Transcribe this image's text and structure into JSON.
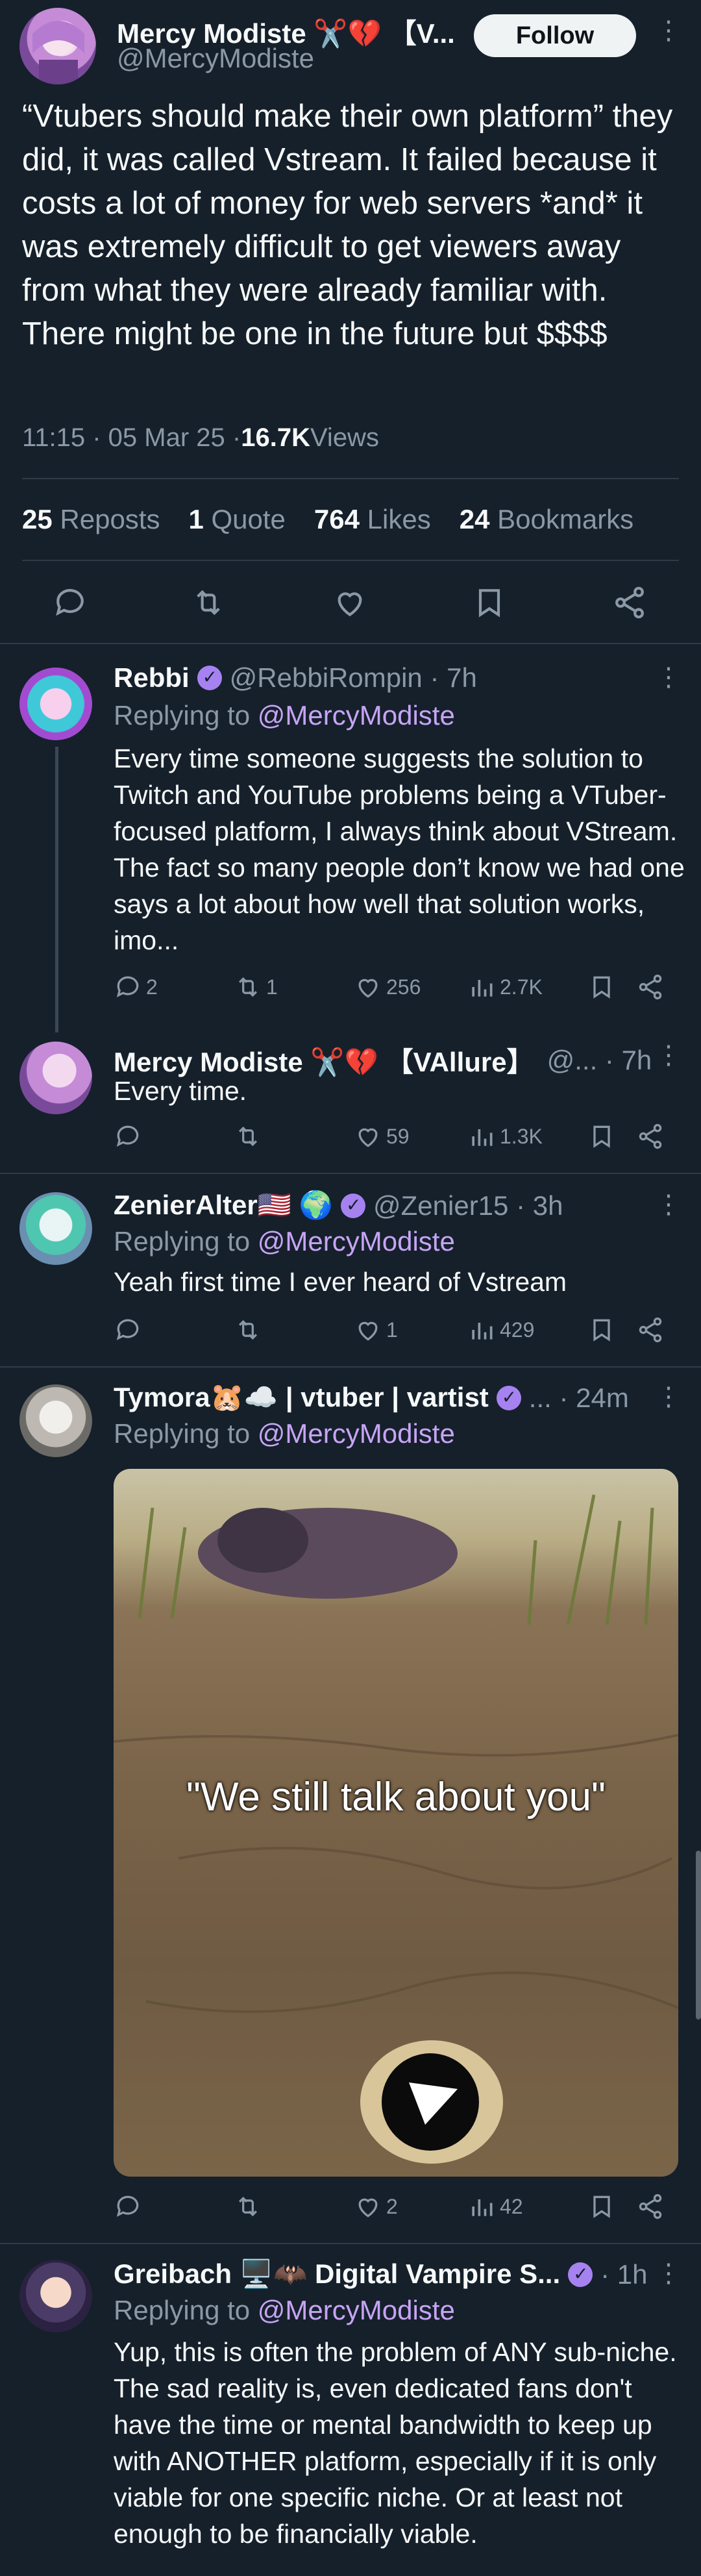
{
  "main_tweet": {
    "author_name": "Mercy Modiste ✂️💔 【V...",
    "author_handle": "@MercyModiste",
    "follow_label": "Follow",
    "text": "“Vtubers should make their own platform” they did, it was called Vstream. It failed because it costs a lot of money for web servers *and* it was extremely difficult to get viewers away from what they were already familiar with. There might be one in the future but $$$$",
    "time": "11:15 · 05 Mar 25 · ",
    "views_count": "16.7K",
    "views_label": " Views",
    "stats": {
      "reposts_count": "25",
      "reposts_label": "Reposts",
      "quotes_count": "1",
      "quotes_label": "Quote",
      "likes_count": "764",
      "likes_label": "Likes",
      "bookmarks_count": "24",
      "bookmarks_label": "Bookmarks"
    }
  },
  "replies": [
    {
      "name": "Rebbi",
      "handle": "@RebbiRompin · 7h",
      "replying_prefix": "Replying to ",
      "replying_to": "@MercyModiste",
      "text": "Every time someone suggests the solution to Twitch and YouTube problems being a VTuber-focused platform, I always think about VStream. The fact so many people don’t know we had one says a lot about how well that solution works, imo...",
      "replies": "2",
      "reposts": "1",
      "likes": "256",
      "views": "2.7K"
    },
    {
      "name": "Mercy Modiste ✂️💔 【VAllure】",
      "handle": "@... · 7h",
      "text": "Every time.",
      "replies": "",
      "reposts": "",
      "likes": "59",
      "views": "1.3K"
    },
    {
      "name": "ZenierAlter🇺🇸 🌍",
      "handle": "@Zenier15 · 3h",
      "replying_prefix": "Replying to ",
      "replying_to": "@MercyModiste",
      "text": "Yeah first time I ever heard of Vstream",
      "replies": "",
      "reposts": "",
      "likes": "1",
      "views": "429"
    },
    {
      "name": "Tymora🐹☁️ | vtuber | vartist",
      "handle": "... · 24m",
      "replying_prefix": "Replying to ",
      "replying_to": "@MercyModiste",
      "image_caption": "\"We still talk about you\"",
      "replies": "",
      "reposts": "",
      "likes": "2",
      "views": "42"
    },
    {
      "name": "Greibach 🖥️🦇 Digital Vampire S...",
      "handle": "· 1h",
      "replying_prefix": "Replying to ",
      "replying_to": "@MercyModiste",
      "text": "Yup, this is often the problem of ANY sub-niche. The sad reality is, even dedicated fans don't have the time or mental bandwidth to keep up with ANOTHER platform, especially if it is only viable for one specific niche. Or at least not enough to be financially viable."
    }
  ],
  "colors": {
    "background": "#15202b",
    "text": "#f7f9f9",
    "muted": "#8b98a5",
    "link": "#c7a4f5",
    "divider": "#2f3b47",
    "verified": "#a682f0"
  }
}
